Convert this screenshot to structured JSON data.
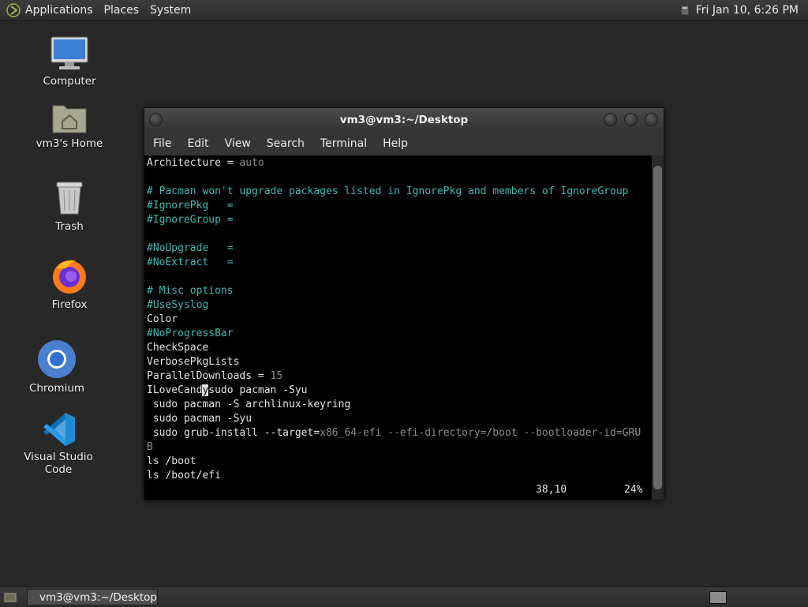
{
  "top_panel": {
    "menus": [
      "Applications",
      "Places",
      "System"
    ],
    "clock": "Fri Jan 10,  6:26 PM"
  },
  "desktop_icons": {
    "computer": "Computer",
    "home": "vm3's Home",
    "trash": "Trash",
    "firefox": "Firefox",
    "chromium": "Chromium",
    "vscode": "Visual Studio Code"
  },
  "window": {
    "title": "vm3@vm3:~/Desktop",
    "menu": [
      "File",
      "Edit",
      "View",
      "Search",
      "Terminal",
      "Help"
    ]
  },
  "terminal": {
    "lines": [
      [
        [
          "w",
          "Architecture = "
        ],
        [
          "g",
          "auto"
        ]
      ],
      [],
      [
        [
          "c",
          "# Pacman won't upgrade packages listed in IgnorePkg and members of IgnoreGroup"
        ]
      ],
      [
        [
          "c",
          "#IgnorePkg   ="
        ]
      ],
      [
        [
          "c",
          "#IgnoreGroup ="
        ]
      ],
      [],
      [
        [
          "c",
          "#NoUpgrade   ="
        ]
      ],
      [
        [
          "c",
          "#NoExtract   ="
        ]
      ],
      [],
      [
        [
          "c",
          "# Misc options"
        ]
      ],
      [
        [
          "c",
          "#UseSyslog"
        ]
      ],
      [
        [
          "w",
          "Color"
        ]
      ],
      [
        [
          "c",
          "#NoProgressBar"
        ]
      ],
      [
        [
          "w",
          "CheckSpace"
        ]
      ],
      [
        [
          "w",
          "VerbosePkgLists"
        ]
      ],
      [
        [
          "w",
          "ParallelDownloads = "
        ],
        [
          "g",
          "15"
        ]
      ],
      [
        [
          "w",
          "ILoveCand"
        ],
        [
          "cursor",
          "y"
        ],
        [
          "w",
          "sudo pacman -Syu"
        ]
      ],
      [
        [
          "w",
          " sudo pacman -S archlinux-keyring"
        ]
      ],
      [
        [
          "w",
          " sudo pacman -Syu"
        ]
      ],
      [
        [
          "w",
          " sudo grub-install --target="
        ],
        [
          "g",
          "x86_64-efi --efi-directory=/boot --bootloader-id=GRU"
        ]
      ],
      [
        [
          "g",
          "B"
        ]
      ],
      [
        [
          "w",
          "ls /boot"
        ]
      ],
      [
        [
          "w",
          "ls /boot/efi"
        ]
      ]
    ],
    "status_position": "38,10",
    "status_percent": "24%"
  },
  "bottom_panel": {
    "task_label": "vm3@vm3:~/Desktop"
  }
}
